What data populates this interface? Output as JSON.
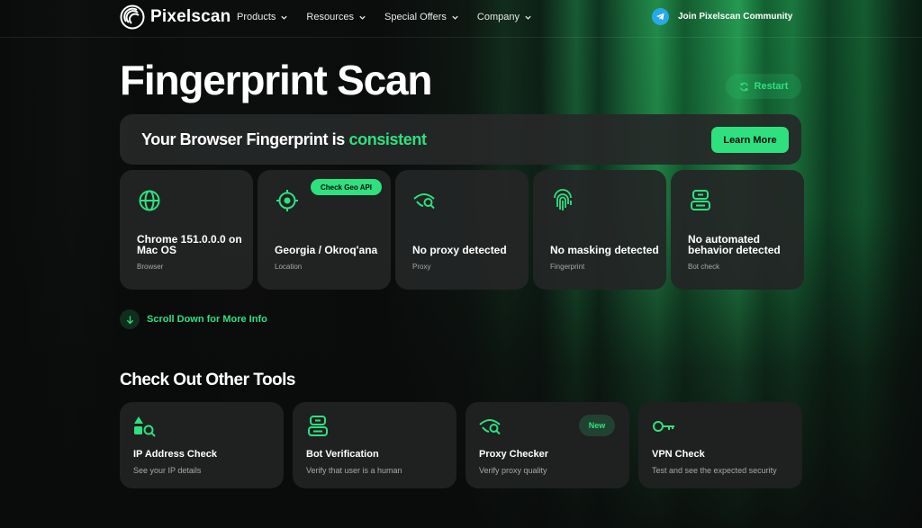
{
  "brand": {
    "name": "Pixelscan",
    "accent": "#2fe07f"
  },
  "header": {
    "nav": [
      {
        "label": "Products"
      },
      {
        "label": "Resources"
      },
      {
        "label": "Special Offers"
      },
      {
        "label": "Company"
      }
    ],
    "community_label": "Join Pixelscan Community"
  },
  "page": {
    "title": "Fingerprint Scan",
    "restart_label": "Restart"
  },
  "banner": {
    "prefix": "Your Browser Fingerprint is",
    "status": "consistent",
    "learn_more_label": "Learn More"
  },
  "cards": [
    {
      "icon": "globe-icon",
      "value": "Chrome 151.0.0.0 on Mac OS",
      "label": "Browser"
    },
    {
      "icon": "location-target-icon",
      "value": "Georgia / Okroq'ana",
      "label": "Location",
      "badge": "Check Geo API"
    },
    {
      "icon": "eye-search-icon",
      "value": "No proxy detected",
      "label": "Proxy"
    },
    {
      "icon": "fingerprint-icon",
      "value": "No masking detected",
      "label": "Fingerprint"
    },
    {
      "icon": "robot-icon",
      "value": "No automated behavior detected",
      "label": "Bot check"
    }
  ],
  "scroll_hint": "Scroll Down for More Info",
  "tools_section": {
    "title": "Check Out Other Tools",
    "tools": [
      {
        "icon": "shapes-search-icon",
        "name": "IP Address Check",
        "desc": "See your IP details"
      },
      {
        "icon": "robot-icon",
        "name": "Bot Verification",
        "desc": "Verify that user is a human"
      },
      {
        "icon": "eye-search-icon",
        "name": "Proxy Checker",
        "desc": "Verify proxy quality",
        "badge": "New"
      },
      {
        "icon": "key-icon",
        "name": "VPN Check",
        "desc": "Test and see the expected security"
      }
    ]
  }
}
